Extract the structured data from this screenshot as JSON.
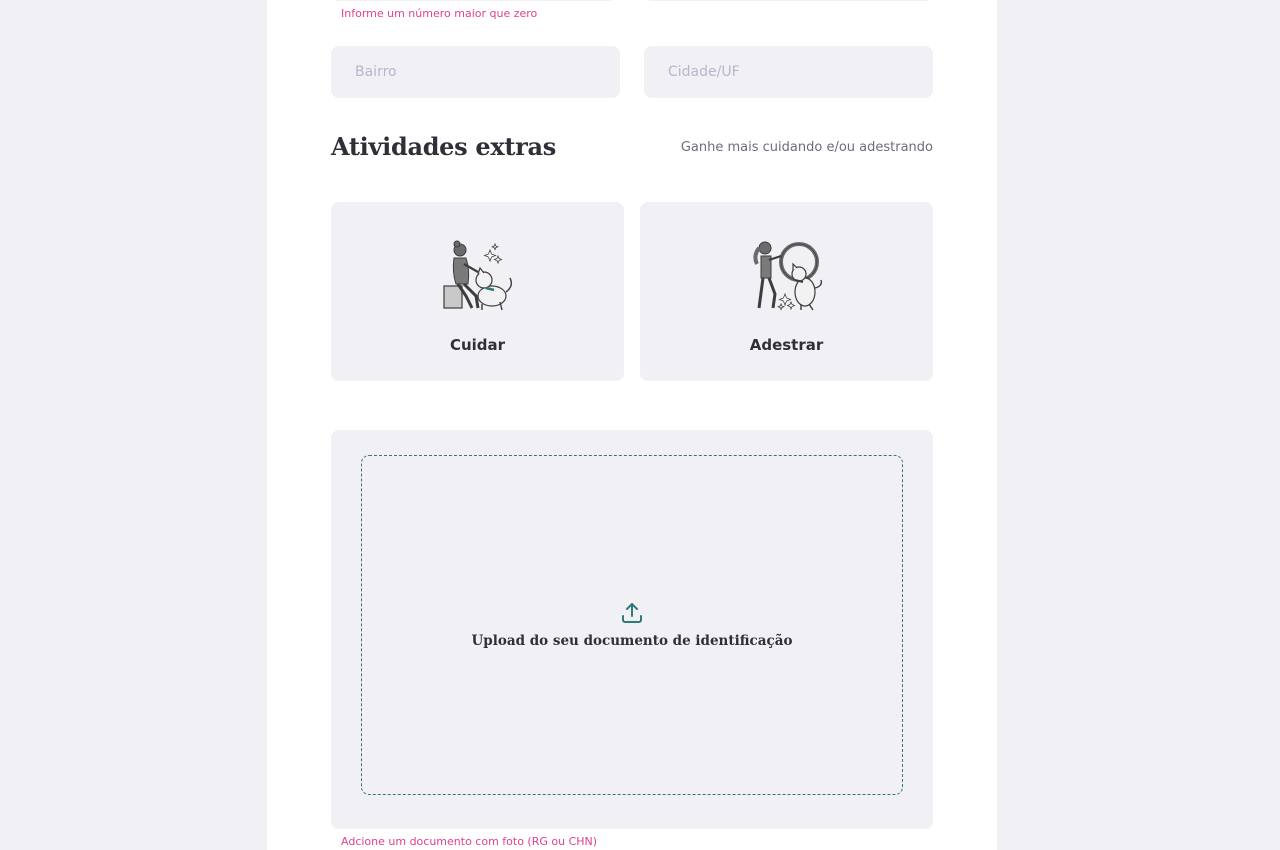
{
  "address": {
    "number_error": "Informe um número maior que zero",
    "neighborhood_placeholder": "Bairro",
    "city_placeholder": "Cidade/UF"
  },
  "extras": {
    "title": "Atividades extras",
    "subtitle": "Ganhe mais cuidando e/ou adestrando",
    "options": [
      {
        "label": "Cuidar",
        "icon": "pet-care-illustration"
      },
      {
        "label": "Adestrar",
        "icon": "pet-training-illustration"
      }
    ]
  },
  "upload": {
    "label": "Upload do seu documento de identificação",
    "icon": "upload-icon",
    "error": "Adcione um documento com foto (RG ou CHN)"
  },
  "colors": {
    "background": "#f0f0f5",
    "error": "#e0428f",
    "accent": "#2f7a79",
    "text": "#312e38"
  }
}
